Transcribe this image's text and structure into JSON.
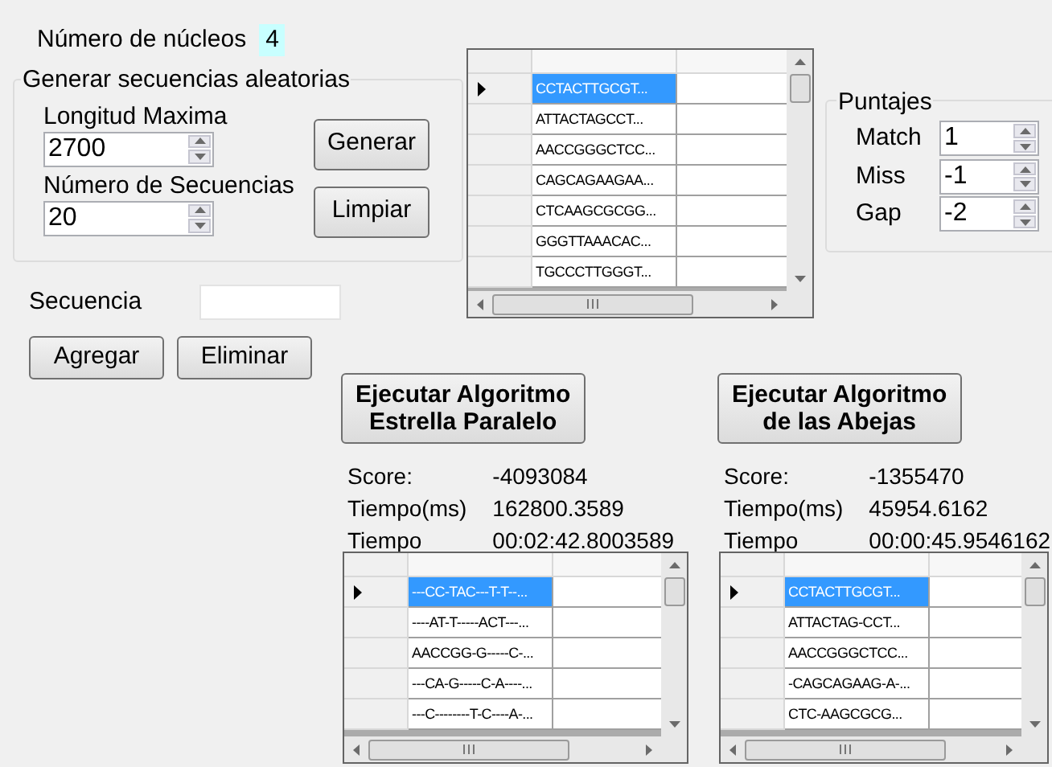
{
  "cores": {
    "label": "Número de núcleos",
    "value": "4"
  },
  "random_group": {
    "title": "Generar secuencias aleatorias",
    "fields": [
      {
        "label": "Longitud Maxima",
        "value": "2700"
      },
      {
        "label": "Número de Secuencias",
        "value": "20"
      }
    ],
    "buttons": [
      "Generar",
      "Limpiar"
    ]
  },
  "sequence": {
    "label": "Secuencia"
  },
  "sequence_buttons": [
    "Agregar",
    "Eliminar"
  ],
  "sequences_grid": {
    "rows": [
      {
        "text": "CCTACTTGCGT...",
        "selected": true
      },
      {
        "text": "ATTACTAGCCT...",
        "selected": false
      },
      {
        "text": "AACCGGGCTCC...",
        "selected": false
      },
      {
        "text": "CAGCAGAAGAA...",
        "selected": false
      },
      {
        "text": "CTCAAGCGCGG...",
        "selected": false
      },
      {
        "text": "GGGTTAAACAC...",
        "selected": false
      },
      {
        "text": "TGCCCTTGGGT...",
        "selected": false
      }
    ]
  },
  "scores": {
    "title": "Puntajes",
    "fields": [
      {
        "label": "Match",
        "value": "1"
      },
      {
        "label": "Miss",
        "value": "-1"
      },
      {
        "label": "Gap",
        "value": "-2"
      }
    ]
  },
  "algorithms": [
    {
      "button": [
        "Ejecutar Algoritmo",
        "Estrella Paralelo"
      ],
      "stats": [
        {
          "label": "Score:",
          "value": "-4093084"
        },
        {
          "label": "Tiempo(ms)",
          "value": "162800.3589"
        },
        {
          "label": "Tiempo",
          "value": "00:02:42.8003589"
        }
      ],
      "rows": [
        {
          "text": "---CC-TAC---T-T--...",
          "selected": true
        },
        {
          "text": "----AT-T-----ACT---...",
          "selected": false
        },
        {
          "text": "AACCGG-G-----C-...",
          "selected": false
        },
        {
          "text": "---CA-G-----C-A----...",
          "selected": false
        },
        {
          "text": "---C--------T-C----A-...",
          "selected": false
        }
      ]
    },
    {
      "button": [
        "Ejecutar Algoritmo",
        "de las Abejas"
      ],
      "stats": [
        {
          "label": "Score:",
          "value": "-1355470"
        },
        {
          "label": "Tiempo(ms)",
          "value": "45954.6162"
        },
        {
          "label": "Tiempo",
          "value": "00:00:45.9546162"
        }
      ],
      "rows": [
        {
          "text": "CCTACTTGCGT...",
          "selected": true
        },
        {
          "text": "ATTACTAG-CCT...",
          "selected": false
        },
        {
          "text": "AACCGGGCTCC...",
          "selected": false
        },
        {
          "text": "-CAGCAGAAG-A-...",
          "selected": false
        },
        {
          "text": "CTC-AAGCGCG...",
          "selected": false
        }
      ]
    }
  ]
}
